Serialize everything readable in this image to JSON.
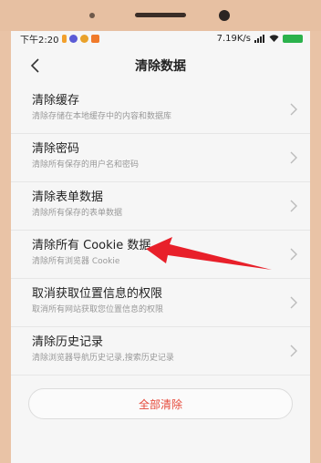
{
  "status": {
    "time": "下午2:20",
    "network": "7.19K/s",
    "battery_color": "#2bb24c"
  },
  "header": {
    "title": "清除数据"
  },
  "items": [
    {
      "title": "清除缓存",
      "subtitle": "清除存储在本地缓存中的内容和数据库"
    },
    {
      "title": "清除密码",
      "subtitle": "清除所有保存的用户名和密码"
    },
    {
      "title": "清除表单数据",
      "subtitle": "清除所有保存的表单数据"
    },
    {
      "title": "清除所有 Cookie 数据",
      "subtitle": "清除所有浏览器 Cookie"
    },
    {
      "title": "取消获取位置信息的权限",
      "subtitle": "取消所有网站获取您位置信息的权限"
    },
    {
      "title": "清除历史记录",
      "subtitle": "清除浏览器导航历史记录,搜索历史记录"
    }
  ],
  "footer": {
    "clear_all_label": "全部清除"
  },
  "colors": {
    "accent_red": "#e6493a",
    "annotation_arrow": "#e8202a"
  }
}
